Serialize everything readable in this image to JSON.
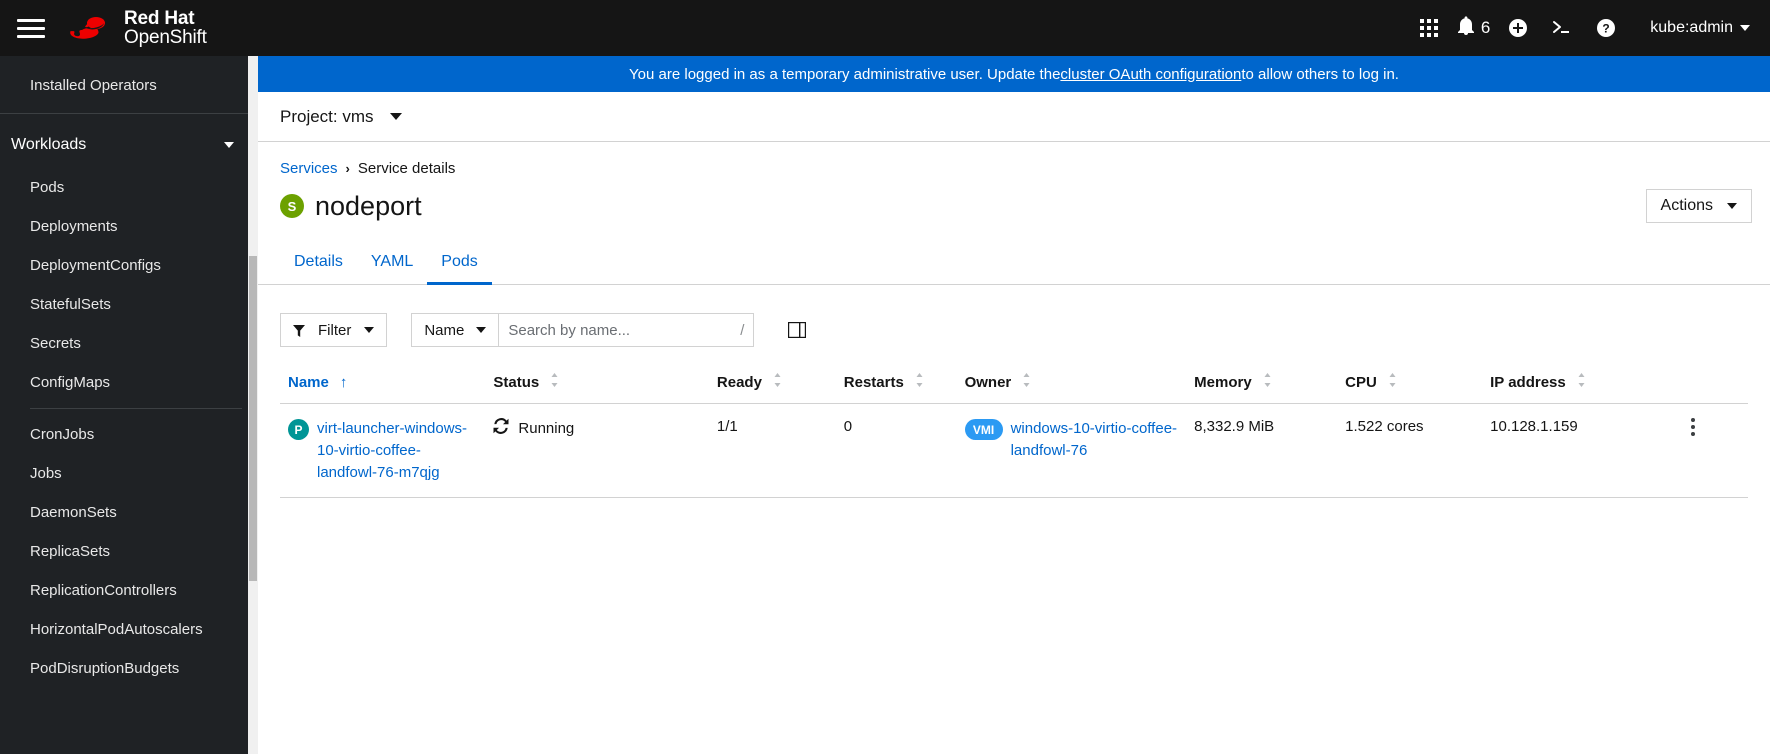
{
  "masthead": {
    "menu_icon": "hamburger-icon",
    "brand_line1": "Red Hat",
    "brand_line2": "OpenShift",
    "apps_icon": "grid-apps-icon",
    "bell_icon": "bell-icon",
    "notification_count": "6",
    "plus_icon": "plus-circle-icon",
    "terminal_icon": "terminal-icon",
    "help_icon": "help-circle-icon",
    "username": "kube:admin"
  },
  "banner": {
    "text_before": "You are logged in as a temporary administrative user. Update the ",
    "link": "cluster OAuth configuration",
    "text_after": " to allow others to log in."
  },
  "sidebar": {
    "items": [
      {
        "label": "Installed Operators",
        "type": "item"
      },
      {
        "label": "",
        "type": "separator"
      },
      {
        "label": "Workloads",
        "type": "section"
      },
      {
        "label": "Pods",
        "type": "item"
      },
      {
        "label": "Deployments",
        "type": "item"
      },
      {
        "label": "DeploymentConfigs",
        "type": "item"
      },
      {
        "label": "StatefulSets",
        "type": "item"
      },
      {
        "label": "Secrets",
        "type": "item"
      },
      {
        "label": "ConfigMaps",
        "type": "item"
      },
      {
        "label": "",
        "type": "separator-inset"
      },
      {
        "label": "CronJobs",
        "type": "item"
      },
      {
        "label": "Jobs",
        "type": "item"
      },
      {
        "label": "DaemonSets",
        "type": "item"
      },
      {
        "label": "ReplicaSets",
        "type": "item"
      },
      {
        "label": "ReplicationControllers",
        "type": "item"
      },
      {
        "label": "HorizontalPodAutoscalers",
        "type": "item"
      },
      {
        "label": "PodDisruptionBudgets",
        "type": "item"
      }
    ]
  },
  "project": {
    "label": "Project: vms"
  },
  "breadcrumb": {
    "parent": "Services",
    "separator": "›",
    "current": "Service details"
  },
  "page": {
    "badge_letter": "S",
    "badge_color": "#6ca100",
    "title": "nodeport",
    "actions_label": "Actions"
  },
  "tabs": [
    {
      "label": "Details",
      "active": false
    },
    {
      "label": "YAML",
      "active": false
    },
    {
      "label": "Pods",
      "active": true
    }
  ],
  "toolbar": {
    "filter_label": "Filter",
    "filter_icon": "funnel-icon",
    "name_select_label": "Name",
    "search_placeholder": "Search by name...",
    "search_value": "",
    "search_shortcut": "/",
    "column_management_icon": "column-management-icon"
  },
  "table": {
    "columns": [
      {
        "label": "Name",
        "sorted": true,
        "direction": "asc"
      },
      {
        "label": "Status",
        "sorted": false
      },
      {
        "label": "Ready",
        "sorted": false
      },
      {
        "label": "Restarts",
        "sorted": false
      },
      {
        "label": "Owner",
        "sorted": false
      },
      {
        "label": "Memory",
        "sorted": false
      },
      {
        "label": "CPU",
        "sorted": false
      },
      {
        "label": "IP address",
        "sorted": false
      }
    ],
    "rows": [
      {
        "name_badge": "P",
        "name": "virt-launcher-windows-10-virtio-coffee-landfowl-76-m7qjg",
        "status": "Running",
        "status_icon": "sync-icon",
        "ready": "1/1",
        "restarts": "0",
        "owner_badge": "VMI",
        "owner": "windows-10-virtio-coffee-landfowl-76",
        "memory": "8,332.9 MiB",
        "cpu": "1.522 cores",
        "ip_address": "10.128.1.159",
        "kebab_icon": "kebab-menu-icon"
      }
    ]
  },
  "colors": {
    "accent": "#06c",
    "masthead_bg": "#151515",
    "sidebar_bg": "#1f2225",
    "banner_bg": "#0066cc",
    "service_badge": "#6ca100",
    "pod_badge": "#009596",
    "vmi_badge": "#2b9af3"
  }
}
